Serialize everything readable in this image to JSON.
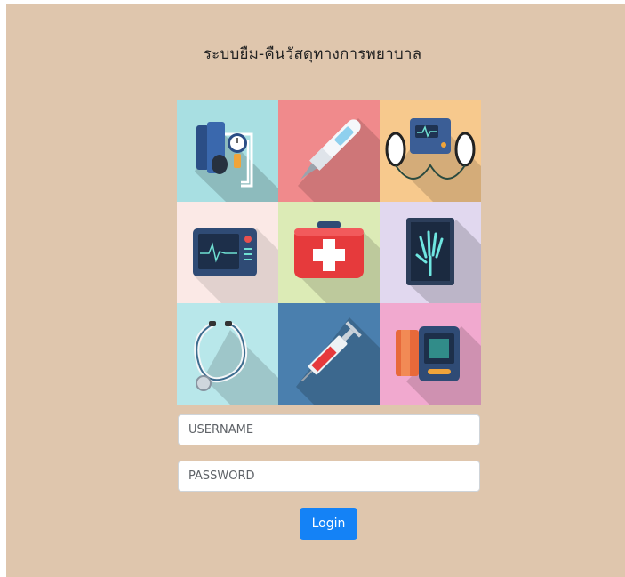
{
  "page": {
    "title": "ระบบยืม-คืนวัสดุทางการพยาบาล"
  },
  "tiles": [
    {
      "icon": "blood-pressure-cuff-icon",
      "bg": "#a8dfe2"
    },
    {
      "icon": "thermometer-icon",
      "bg": "#f08a8c"
    },
    {
      "icon": "defibrillator-icon",
      "bg": "#f7c98d"
    },
    {
      "icon": "heart-monitor-icon",
      "bg": "#fbe9e6"
    },
    {
      "icon": "first-aid-kit-icon",
      "bg": "#dcebb6"
    },
    {
      "icon": "xray-hand-icon",
      "bg": "#e1d8ef"
    },
    {
      "icon": "stethoscope-icon",
      "bg": "#b8e7ea"
    },
    {
      "icon": "syringe-icon",
      "bg": "#4a7fae"
    },
    {
      "icon": "digital-bp-monitor-icon",
      "bg": "#f1a9cf"
    }
  ],
  "form": {
    "username_placeholder": "USERNAME",
    "password_placeholder": "PASSWORD",
    "login_label": "Login"
  },
  "colors": {
    "background": "#dfc6ad",
    "button": "#1482f6"
  }
}
